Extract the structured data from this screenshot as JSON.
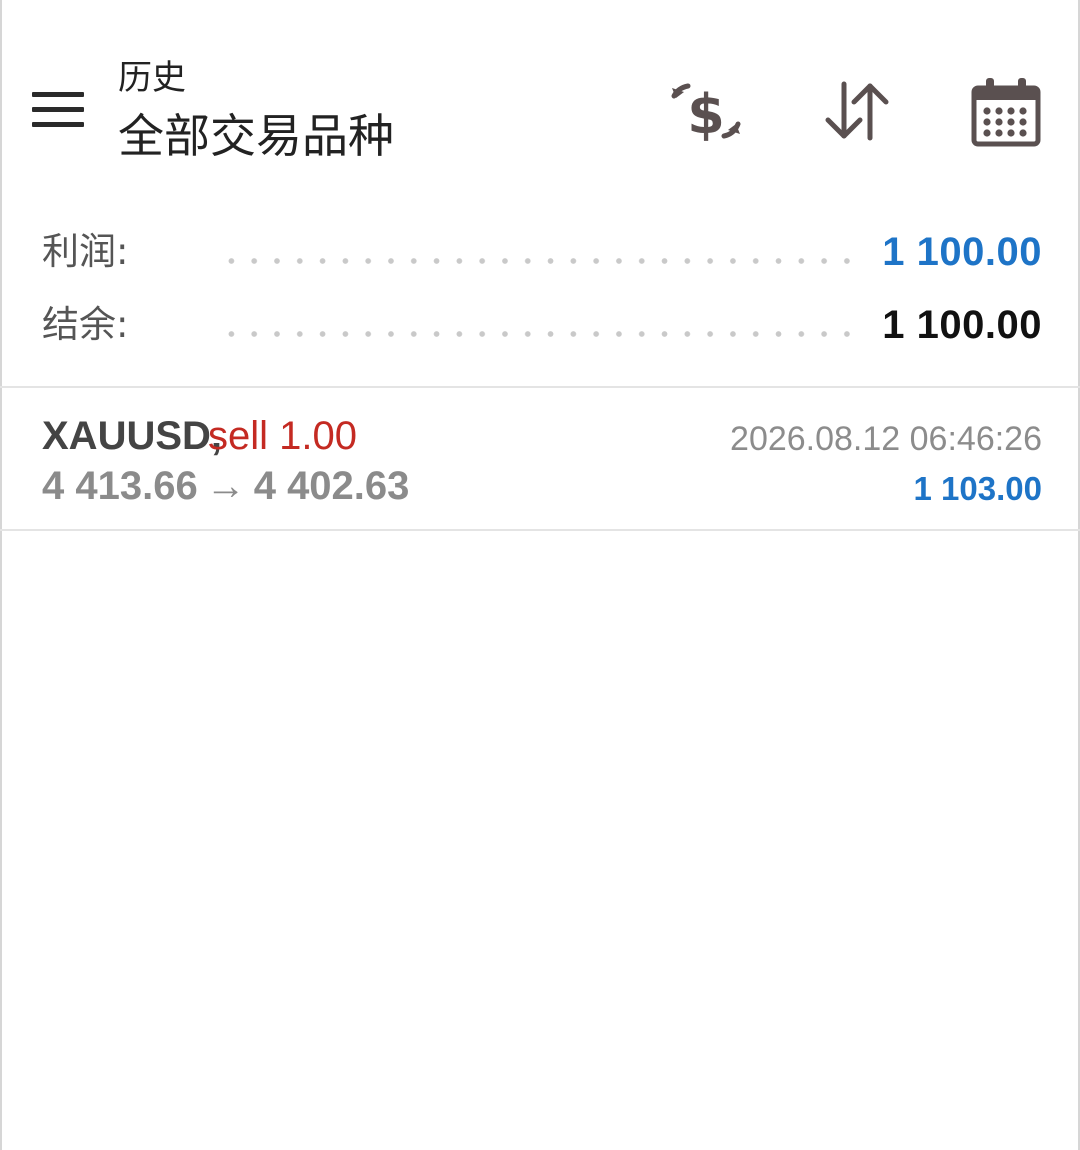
{
  "header": {
    "subtitle": "历史",
    "title": "全部交易品种",
    "icons": [
      "menu-icon",
      "currency-exchange-icon",
      "sort-icon",
      "calendar-icon"
    ]
  },
  "summary": {
    "profit_label": "利润:",
    "profit_value": "1 100.00",
    "balance_label": "结余:",
    "balance_value": "1 100.00"
  },
  "trades": [
    {
      "symbol": "XAUUSD,",
      "side": "sell 1.00",
      "open_price": "4 413.66",
      "arrow": "→",
      "close_price": "4 402.63",
      "time": "2026.08.12 06:46:26",
      "profit": "1 103.00"
    }
  ],
  "colors": {
    "accent_blue": "#1e74c7",
    "sell_red": "#c42a22",
    "icon_gray": "#5a5050"
  }
}
